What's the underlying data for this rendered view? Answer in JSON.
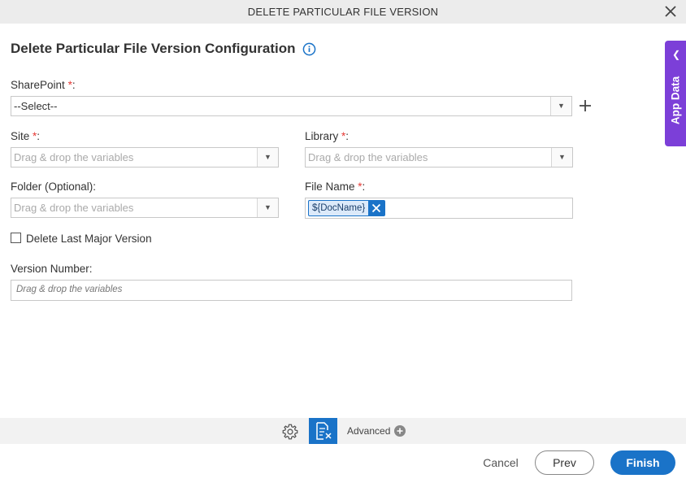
{
  "dialog": {
    "title": "DELETE PARTICULAR FILE VERSION",
    "heading": "Delete Particular File Version Configuration"
  },
  "form": {
    "sharepoint": {
      "label": "SharePoint",
      "required_mark": "*",
      "colon": ":",
      "value": "--Select--"
    },
    "site": {
      "label": "Site",
      "required_mark": "*",
      "colon": ":",
      "placeholder": "Drag & drop the variables"
    },
    "library": {
      "label": "Library",
      "required_mark": "*",
      "colon": ":",
      "placeholder": "Drag & drop the variables"
    },
    "folder": {
      "label": "Folder (Optional):",
      "placeholder": "Drag & drop the variables"
    },
    "file_name": {
      "label": "File Name",
      "required_mark": "*",
      "colon": ":",
      "chip": "${DocName}"
    },
    "delete_last_major": {
      "label": "Delete Last Major Version",
      "checked": false
    },
    "version_number": {
      "label": "Version Number:",
      "placeholder": "Drag & drop the variables"
    }
  },
  "side_panel": {
    "label": "App Data"
  },
  "toolbar": {
    "advanced_label": "Advanced"
  },
  "footer": {
    "cancel": "Cancel",
    "prev": "Prev",
    "finish": "Finish"
  },
  "colors": {
    "accent": "#1a73c8",
    "app_data": "#7c3fd8",
    "required": "#e53935"
  }
}
